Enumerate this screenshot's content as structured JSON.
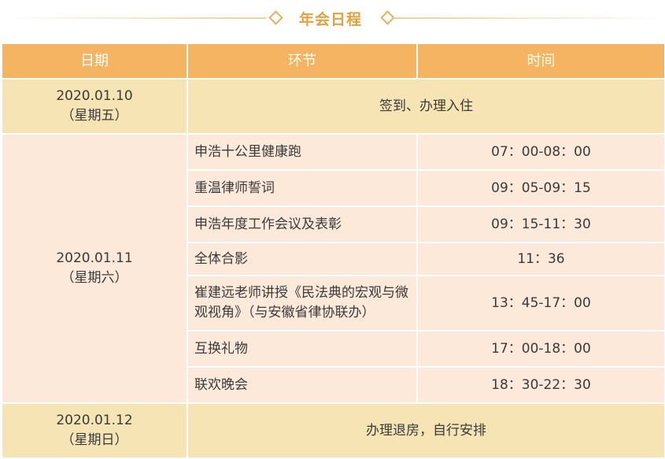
{
  "title": "年会日程",
  "headers": {
    "date": "日期",
    "session": "环节",
    "time": "时间"
  },
  "day1": {
    "date": "2020.01.10",
    "weekday": "（星期五）",
    "activity": "签到、办理入住"
  },
  "day2": {
    "date": "2020.01.11",
    "weekday": "（星期六）",
    "items": [
      {
        "session": "申浩十公里健康跑",
        "time": "07：00-08：00"
      },
      {
        "session": "重温律师誓词",
        "time": "09：05-09：15"
      },
      {
        "session": "申浩年度工作会议及表彰",
        "time": "09：15-11：30"
      },
      {
        "session": "全体合影",
        "time": "11：36"
      },
      {
        "session": "崔建远老师讲授《民法典的宏观与微观视角》（与安徽省律协联办）",
        "time": "13：45-17：00"
      },
      {
        "session": "互换礼物",
        "time": "17：00-18：00"
      },
      {
        "session": "联欢晚会",
        "time": "18：30-22：30"
      }
    ]
  },
  "day3": {
    "date": "2020.01.12",
    "weekday": "（星期日）",
    "activity": "办理退房，自行安排"
  },
  "colors": {
    "header": "#f5b462",
    "title": "#e2a23e",
    "row_light": "#fde9da",
    "row_gold": "#f7e4b4"
  }
}
